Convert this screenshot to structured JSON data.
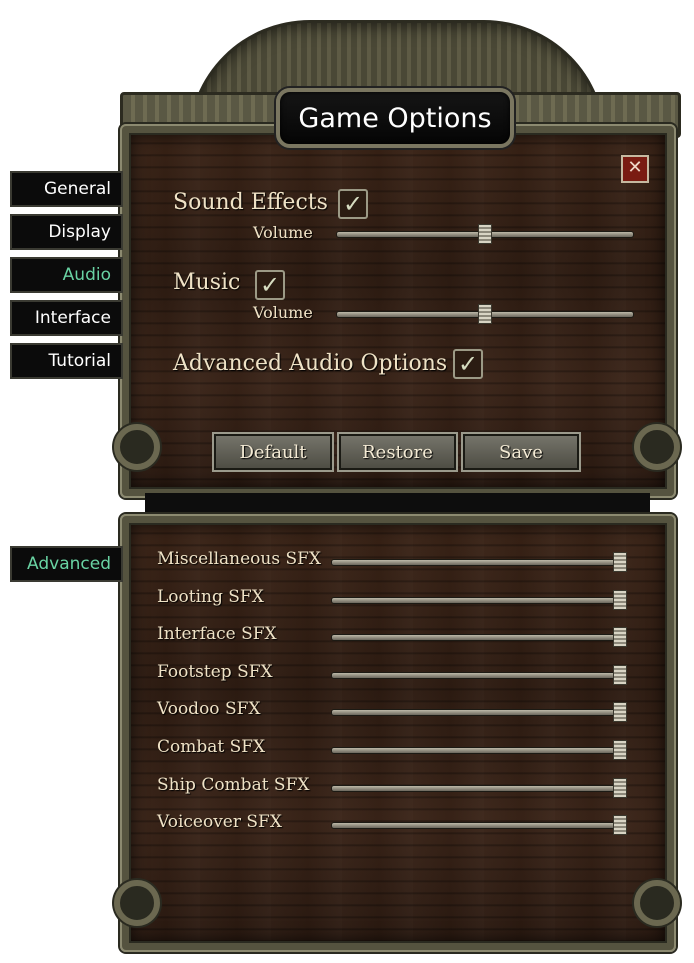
{
  "window": {
    "title": "Game Options",
    "close_glyph": "✕"
  },
  "tabs": [
    {
      "label": "General",
      "active": false
    },
    {
      "label": "Display",
      "active": false
    },
    {
      "label": "Audio",
      "active": true
    },
    {
      "label": "Interface",
      "active": false
    },
    {
      "label": "Tutorial",
      "active": false
    }
  ],
  "audio": {
    "sound_effects": {
      "label": "Sound Effects",
      "checked": true,
      "volume_label": "Volume",
      "volume": 0.5
    },
    "music": {
      "label": "Music",
      "checked": true,
      "volume_label": "Volume",
      "volume": 0.5
    },
    "advanced": {
      "label": "Advanced Audio Options",
      "checked": true
    },
    "check_glyph": "✓"
  },
  "buttons": {
    "default": "Default",
    "restore": "Restore",
    "save": "Save"
  },
  "advanced_panel": {
    "tab_label": "Advanced",
    "rows": [
      {
        "label": "Miscellaneous SFX",
        "value": 1.0
      },
      {
        "label": "Looting SFX",
        "value": 1.0
      },
      {
        "label": "Interface SFX",
        "value": 1.0
      },
      {
        "label": "Footstep SFX",
        "value": 1.0
      },
      {
        "label": "Voodoo SFX",
        "value": 1.0
      },
      {
        "label": "Combat SFX",
        "value": 1.0
      },
      {
        "label": "Ship Combat SFX",
        "value": 1.0
      },
      {
        "label": "Voiceover SFX",
        "value": 1.0
      }
    ]
  },
  "colors": {
    "active_tab_text": "#69d3a3",
    "label_text": "#efe2c6",
    "close_button": "#7a1c12"
  }
}
